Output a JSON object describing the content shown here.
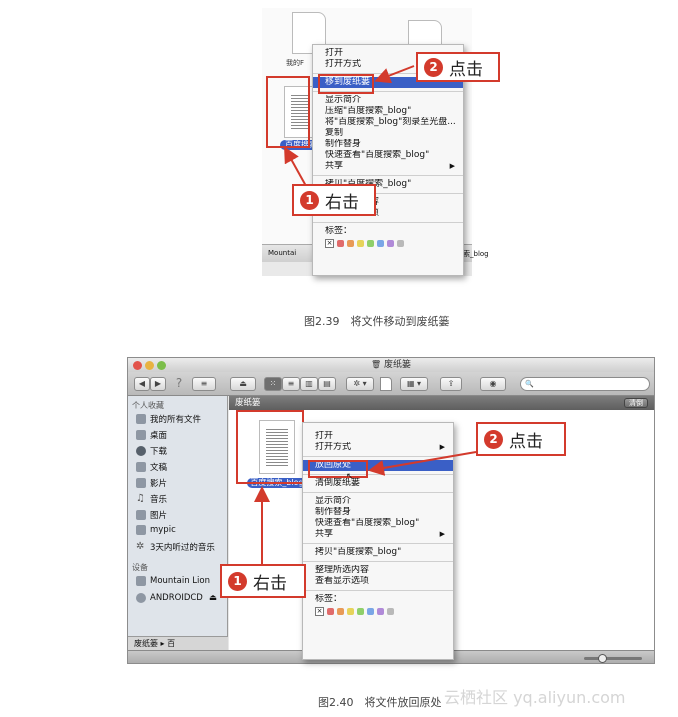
{
  "figure1": {
    "caption": "图2.39　将文件移动到废纸篓",
    "bg_file_labels": [
      "我的F",
      "P"
    ],
    "desktop_file_label": "百度搜索",
    "dock_items": [
      "Mountai",
      "百度搜索_blog"
    ],
    "menu": {
      "group1": [
        "打开",
        "打开方式"
      ],
      "highlighted": "移到废纸篓",
      "group2": [
        "显示简介",
        "压缩\"百度搜索_blog\"",
        "将\"百度搜索_blog\"刻录至光盘...",
        "复制",
        "制作替身",
        "快速查看\"百度搜索_blog\"",
        "共享"
      ],
      "group3": [
        "拷贝\"百度搜索_blog\"",
        "整理所选内容",
        "查看显示选项"
      ],
      "tags_label": "标签：",
      "tag_clear": "×"
    },
    "callout_right_click": {
      "number": "1",
      "text": "右击"
    },
    "callout_click": {
      "number": "2",
      "text": "点击"
    }
  },
  "figure2": {
    "caption": "图2.40　将文件放回原处",
    "window_title": "废纸篓",
    "toolbar": {
      "back": "◀",
      "forward": "▶",
      "help": "?",
      "eject": "⏏",
      "view_icons": "⁙",
      "view_list": "≡",
      "view_columns": "▥",
      "view_coverflow": "▤",
      "action": "✲ ▾",
      "arrange": "▦ ▾",
      "share": "⇪",
      "preview": "◉",
      "search_icon": "🔍"
    },
    "sidebar": {
      "favorites_header": "个人收藏",
      "favorites": [
        {
          "icon": "all-files-icon",
          "label": "我的所有文件"
        },
        {
          "icon": "desktop-icon",
          "label": "桌面"
        },
        {
          "icon": "downloads-icon",
          "label": "下载"
        },
        {
          "icon": "documents-icon",
          "label": "文稿"
        },
        {
          "icon": "movies-icon",
          "label": "影片"
        },
        {
          "icon": "music-icon",
          "label": "音乐"
        },
        {
          "icon": "pictures-icon",
          "label": "图片"
        },
        {
          "icon": "folder-icon",
          "label": "mypic"
        },
        {
          "icon": "gear-icon",
          "label": "3天内听过的音乐"
        }
      ],
      "devices_header": "设备",
      "devices": [
        {
          "icon": "disk-icon",
          "label": "Mountain Lion"
        },
        {
          "icon": "cd-icon",
          "label": "ANDROIDCD"
        }
      ]
    },
    "content_header": "废纸篓",
    "empty_button": "清倒",
    "file_label": "百度搜索_blog",
    "pathbar": "废纸篓 ▸ 百",
    "menu": {
      "group1": [
        "打开",
        "打开方式"
      ],
      "highlighted": "放回原处",
      "group2": [
        "清倒废纸篓"
      ],
      "group3": [
        "显示简介",
        "制作替身",
        "快速查看\"百度搜索_blog\"",
        "共享"
      ],
      "group4": [
        "拷贝\"百度搜索_blog\""
      ],
      "group5": [
        "整理所选内容",
        "查看显示选项"
      ],
      "tags_label": "标签：",
      "tag_clear": "×"
    },
    "callout_right_click": {
      "number": "1",
      "text": "右击"
    },
    "callout_click": {
      "number": "2",
      "text": "点击"
    }
  },
  "watermark": "云栖社区 yq.aliyun.com",
  "colors": {
    "callout_red": "#d33a2c",
    "highlight_blue": "#3a5fc6",
    "tag_colors": [
      "#e06b6b",
      "#e89a57",
      "#e6d35a",
      "#8fcf6a",
      "#7aa6e6",
      "#b08ad8",
      "#b9b9b9"
    ]
  }
}
